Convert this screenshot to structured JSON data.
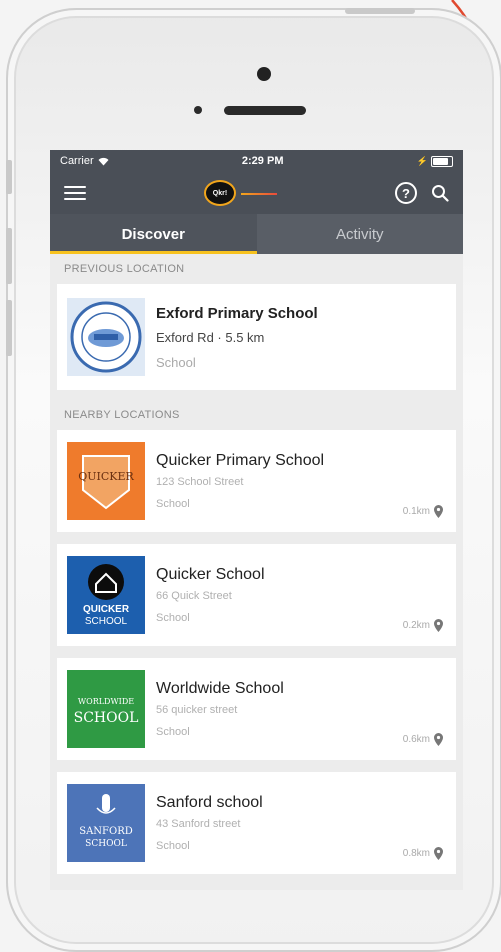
{
  "status": {
    "carrier": "Carrier",
    "time": "2:29 PM",
    "battery_level": 0.9
  },
  "header": {
    "logo_text": "Qkr!"
  },
  "tabs": [
    {
      "label": "Discover",
      "active": true
    },
    {
      "label": "Activity",
      "active": false
    }
  ],
  "previous": {
    "section_label": "PREVIOUS LOCATION",
    "item": {
      "name": "Exford Primary School",
      "address": "Exford Rd · 5.5 km",
      "category": "School"
    }
  },
  "nearby": {
    "section_label": "NEARBY LOCATIONS",
    "items": [
      {
        "name": "Quicker Primary School",
        "address": "123 School Street",
        "category": "School",
        "distance": "0.1km",
        "logo_text": "QUICKER"
      },
      {
        "name": "Quicker School",
        "address": "66 Quick Street",
        "category": "School",
        "distance": "0.2km",
        "logo_text": "QUICKER",
        "logo_sub": "SCHOOL"
      },
      {
        "name": "Worldwide School",
        "address": "56 quicker street",
        "category": "School",
        "distance": "0.6km",
        "logo_text": "WORLDWIDE",
        "logo_sub": "SCHOOL"
      },
      {
        "name": "Sanford school",
        "address": "43 Sanford street",
        "category": "School",
        "distance": "0.8km",
        "logo_text": "SANFORD",
        "logo_sub": "SCHOOL"
      }
    ]
  },
  "colors": {
    "accent": "#f7c21f",
    "navbar": "#4a4f57",
    "arrow": "#e0492f"
  },
  "icons": [
    "menu-icon",
    "help-icon",
    "search-icon",
    "map-pin-icon",
    "wifi-icon",
    "battery-icon"
  ]
}
